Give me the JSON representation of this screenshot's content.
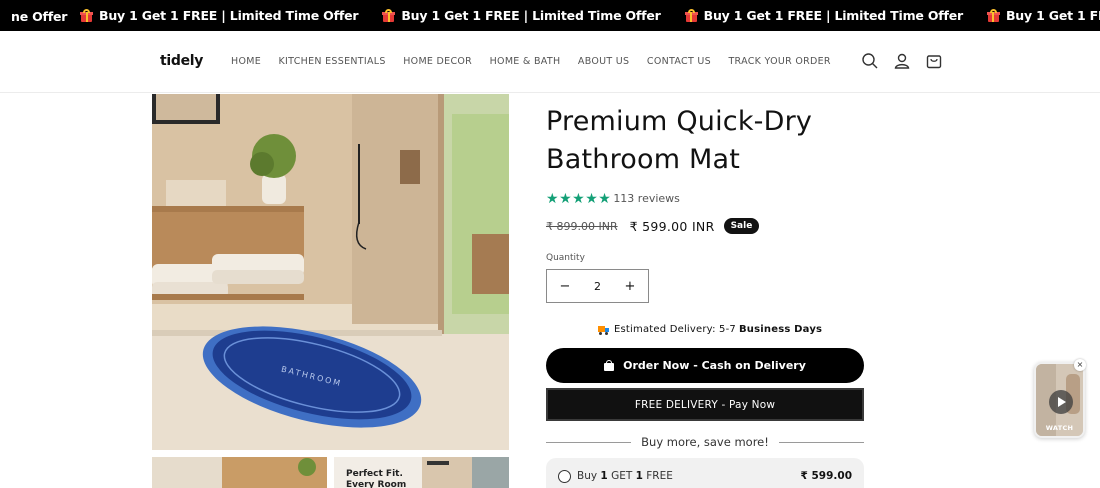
{
  "announcement": {
    "first_fragment": "ne Offer",
    "items": [
      "Buy 1 Get 1 FREE | Limited Time Offer",
      "Buy 1 Get 1 FREE | Limited Time Offer",
      "Buy 1 Get 1 FREE | Limited Time Offer",
      "Buy 1 Get 1 FREE | Limited Time Offer"
    ],
    "background": "#000000"
  },
  "header": {
    "logo_text": "tidely",
    "nav": [
      "HOME",
      "KITCHEN ESSENTIALS",
      "HOME DECOR",
      "HOME & BATH",
      "ABOUT US",
      "CONTACT US",
      "TRACK YOUR ORDER"
    ],
    "icons": [
      "search-icon",
      "account-icon",
      "cart-icon"
    ]
  },
  "product": {
    "title": "Premium Quick-Dry Bathroom Mat",
    "rating": 5,
    "reviews_label": "113 reviews",
    "price_regular": "₹ 899.00 INR",
    "price_sale": "₹ 599.00 INR",
    "sale_badge": "Sale",
    "quantity_label": "Quantity",
    "quantity_value": "2",
    "qty_minus": "−",
    "qty_plus": "+",
    "delivery_prefix": "Estimated Delivery: 5-7",
    "delivery_bold": "Business Days",
    "cod_button": "Order Now - Cash on Delivery",
    "prepaid_button": "FREE DELIVERY - Pay Now",
    "bundle_heading": "Buy more, save more!",
    "bundle_option": {
      "label_prefix": "Buy",
      "label_one": "1",
      "label_get": "GET",
      "label_free_count": "1",
      "label_free": "FREE",
      "price": "₹ 599.00"
    },
    "mat_text": "BATHROOM",
    "thumb2_text_line1": "Perfect Fit.",
    "thumb2_text_line2": "Every Room"
  },
  "watch_widget": {
    "label": "WATCH",
    "close": "×"
  },
  "colors": {
    "rating_green": "#14a077",
    "button_black": "#000000",
    "mat_blue": "#1e3d8f"
  }
}
